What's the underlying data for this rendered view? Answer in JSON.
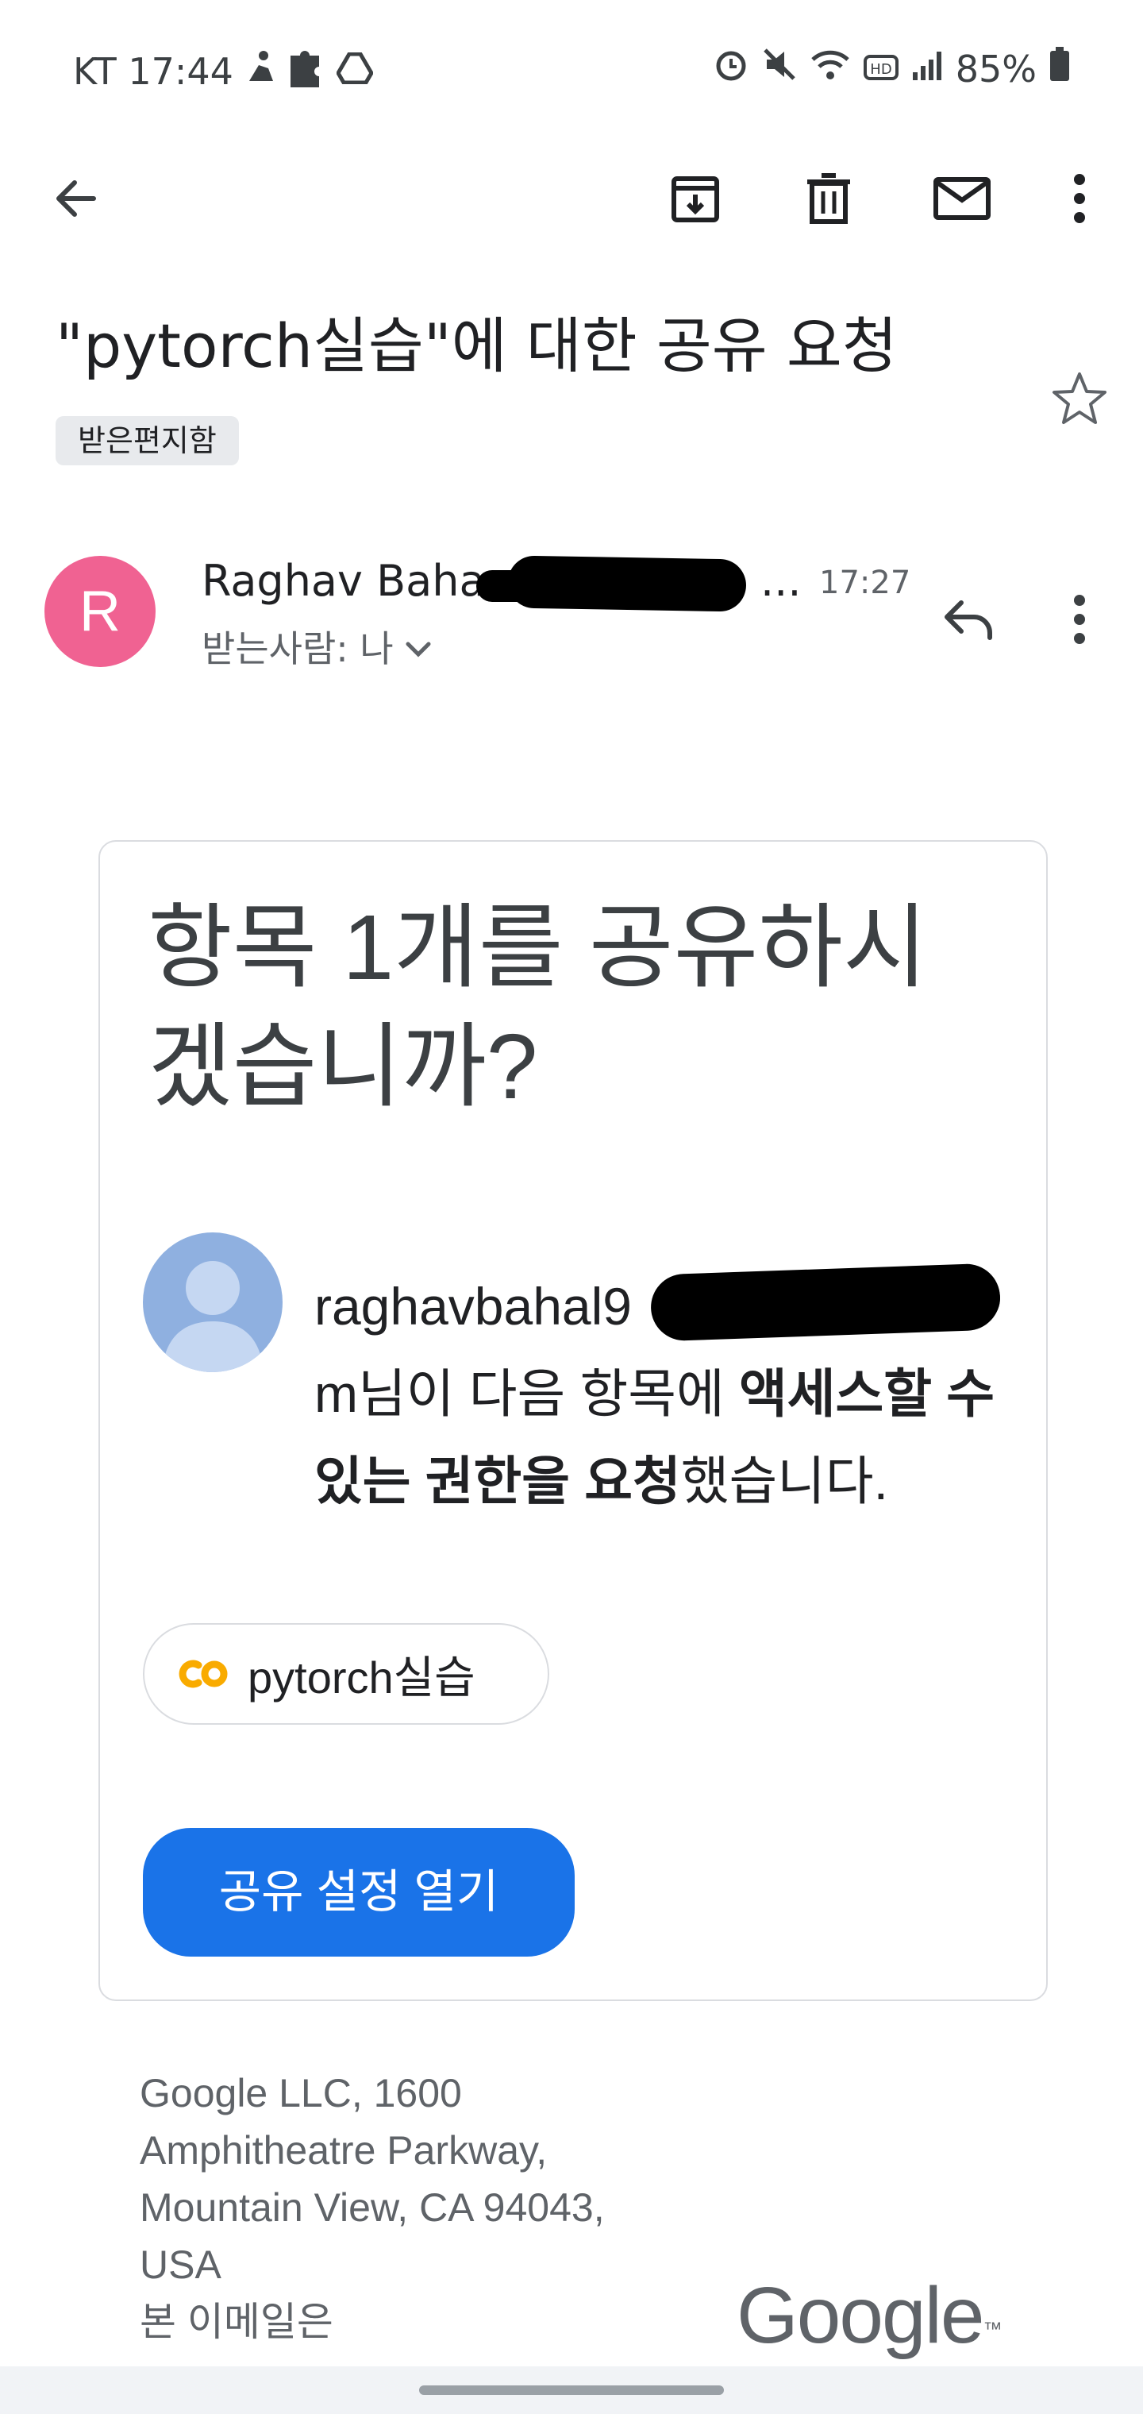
{
  "status_bar": {
    "carrier_time": "KT 17:44",
    "battery": "85%",
    "icons_left": [
      "pilates-icon",
      "puzzle-icon",
      "drive-icon"
    ],
    "icons_right": [
      "alarm-icon",
      "mute-icon",
      "wifi-icon",
      "hd-icon",
      "signal-icon",
      "battery-icon"
    ]
  },
  "toolbar": {
    "back_icon": "back-arrow-icon",
    "actions": [
      "archive-icon",
      "delete-icon",
      "mark-unread-icon",
      "more-vert-icon"
    ]
  },
  "email": {
    "subject": "\"pytorch실습\"에 대한 공유 요청",
    "label": "받은편지함",
    "sender_initial": "R",
    "sender_name": "Raghav Baha",
    "sender_ellipsis": "...",
    "time": "17:27",
    "to_line": "받는사람: 나"
  },
  "card": {
    "title": "항목 1개를 공유하시겠습니까?",
    "requester_visible": "raghavbahal9",
    "message_line2_prefix": "m님이 다음 항목에 ",
    "message_bold": "액세스할 수 있는 권한을 요청",
    "message_suffix": "했습니다.",
    "file_name": "pytorch실습",
    "file_icon": "colab-icon",
    "button_label": "공유 설정 열기"
  },
  "footer": {
    "address": "Google LLC, 1600\nAmphitheatre Parkway,\nMountain View, CA 94043,\nUSA\n본 이메일은",
    "logo_text": "Google",
    "logo_tm": "™"
  },
  "colors": {
    "avatar_bg": "#f06292",
    "button_bg": "#1a73e8",
    "chip_bg": "#e8eaed",
    "colab_orange": "#f9ab00"
  }
}
